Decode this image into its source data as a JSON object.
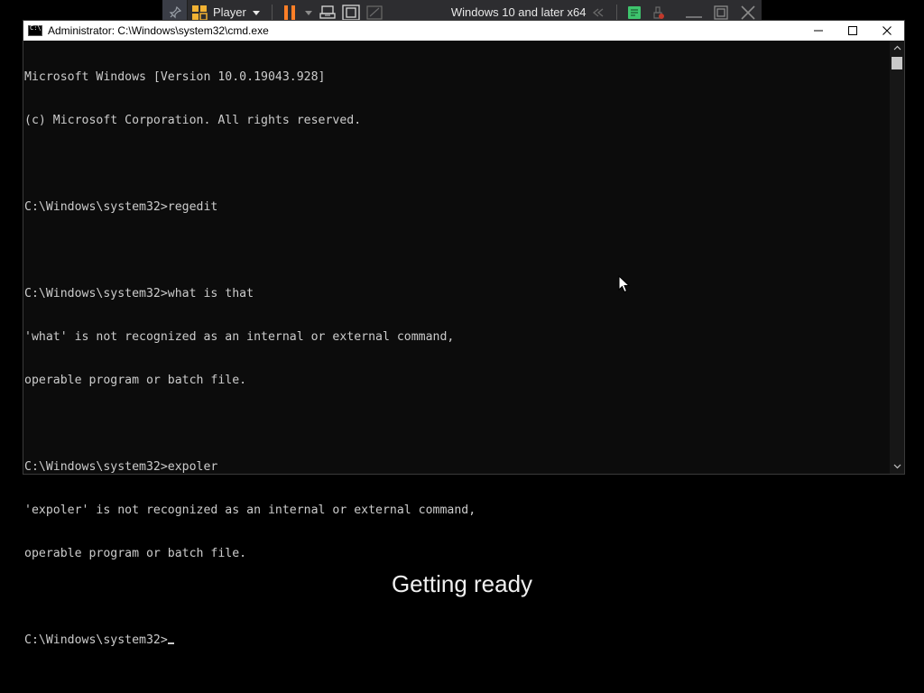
{
  "vm_toolbar": {
    "player_label": "Player",
    "vm_name": "Windows 10 and later x64",
    "colors": {
      "background": "#2d2d30",
      "pause": "#ff7f27",
      "accent_green": "#3ec46d"
    },
    "icons": [
      "pin-icon",
      "player-logo-icon",
      "dropdown-icon",
      "pause-icon",
      "send-ctrl-alt-del-icon",
      "fullscreen-icon",
      "unity-icon",
      "back-icon",
      "notes-icon",
      "removable-devices-icon",
      "minimize-icon",
      "restore-icon",
      "close-icon"
    ]
  },
  "cmd_window": {
    "title": "Administrator: C:\\Windows\\system32\\cmd.exe",
    "lines": [
      "Microsoft Windows [Version 10.0.19043.928]",
      "(c) Microsoft Corporation. All rights reserved.",
      "",
      "C:\\Windows\\system32>regedit",
      "",
      "C:\\Windows\\system32>what is that",
      "'what' is not recognized as an internal or external command,",
      "operable program or batch file.",
      "",
      "C:\\Windows\\system32>expoler",
      "'expoler' is not recognized as an internal or external command,",
      "operable program or batch file.",
      ""
    ],
    "prompt": "C:\\Windows\\system32>"
  },
  "status": {
    "text": "Getting ready"
  }
}
